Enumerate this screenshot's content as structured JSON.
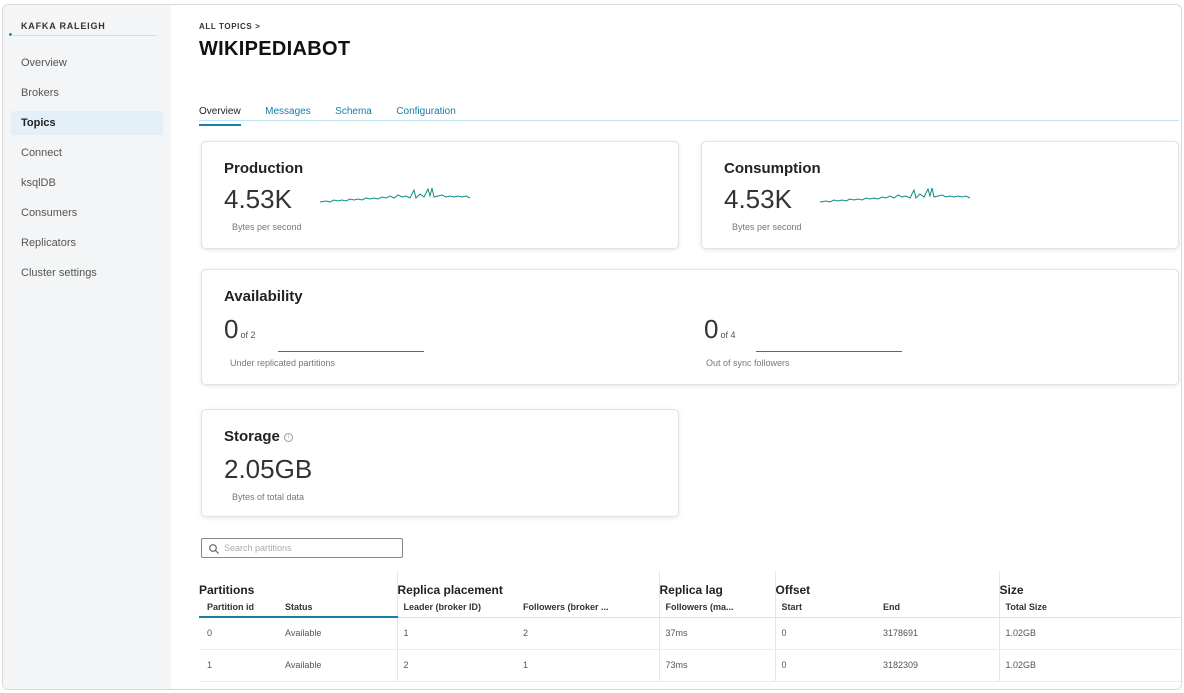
{
  "sidebar": {
    "cluster_name": "KAFKA RALEIGH",
    "items": [
      {
        "label": "Overview",
        "active": false
      },
      {
        "label": "Brokers",
        "active": false
      },
      {
        "label": "Topics",
        "active": true
      },
      {
        "label": "Connect",
        "active": false
      },
      {
        "label": "ksqlDB",
        "active": false
      },
      {
        "label": "Consumers",
        "active": false
      },
      {
        "label": "Replicators",
        "active": false
      },
      {
        "label": "Cluster settings",
        "active": false
      }
    ]
  },
  "header": {
    "breadcrumb": "ALL TOPICS >",
    "title": "WIKIPEDIABOT",
    "tabs": [
      {
        "label": "Overview",
        "active": true
      },
      {
        "label": "Messages",
        "active": false
      },
      {
        "label": "Schema",
        "active": false
      },
      {
        "label": "Configuration",
        "active": false
      }
    ]
  },
  "production": {
    "title": "Production",
    "value": "4.53K",
    "unit": "Bytes per second"
  },
  "consumption": {
    "title": "Consumption",
    "value": "4.53K",
    "unit": "Bytes per second"
  },
  "availability": {
    "title": "Availability",
    "under_replicated": {
      "value": "0",
      "of": "of 2",
      "label": "Under replicated partitions"
    },
    "out_of_sync": {
      "value": "0",
      "of": "of 4",
      "label": "Out of sync followers"
    }
  },
  "storage": {
    "title": "Storage",
    "value": "2.05GB",
    "unit": "Bytes of total data",
    "info_icon": "info-circle-icon"
  },
  "search": {
    "placeholder": "Search partitions",
    "icon": "search-icon"
  },
  "table": {
    "groups": {
      "partitions": "Partitions",
      "replica_placement": "Replica placement",
      "replica_lag": "Replica lag",
      "offset": "Offset",
      "size": "Size"
    },
    "columns": {
      "partition_id": "Partition id",
      "status": "Status",
      "leader": "Leader (broker ID)",
      "followers": "Followers (broker ...",
      "lag": "Followers (ma...",
      "start": "Start",
      "end": "End",
      "total_size": "Total Size"
    },
    "rows": [
      {
        "partition_id": "0",
        "status": "Available",
        "leader": "1",
        "followers": "2",
        "lag": "37ms",
        "start": "0",
        "end": "3178691",
        "total_size": "1.02GB"
      },
      {
        "partition_id": "1",
        "status": "Available",
        "leader": "2",
        "followers": "1",
        "lag": "73ms",
        "start": "0",
        "end": "3182309",
        "total_size": "1.02GB"
      }
    ]
  },
  "colors": {
    "accent": "#1a7fa6",
    "sparkline": "#0e8a8a",
    "sidebar_bg": "#f4f5f6",
    "active_nav_bg": "#e3f0f7"
  }
}
